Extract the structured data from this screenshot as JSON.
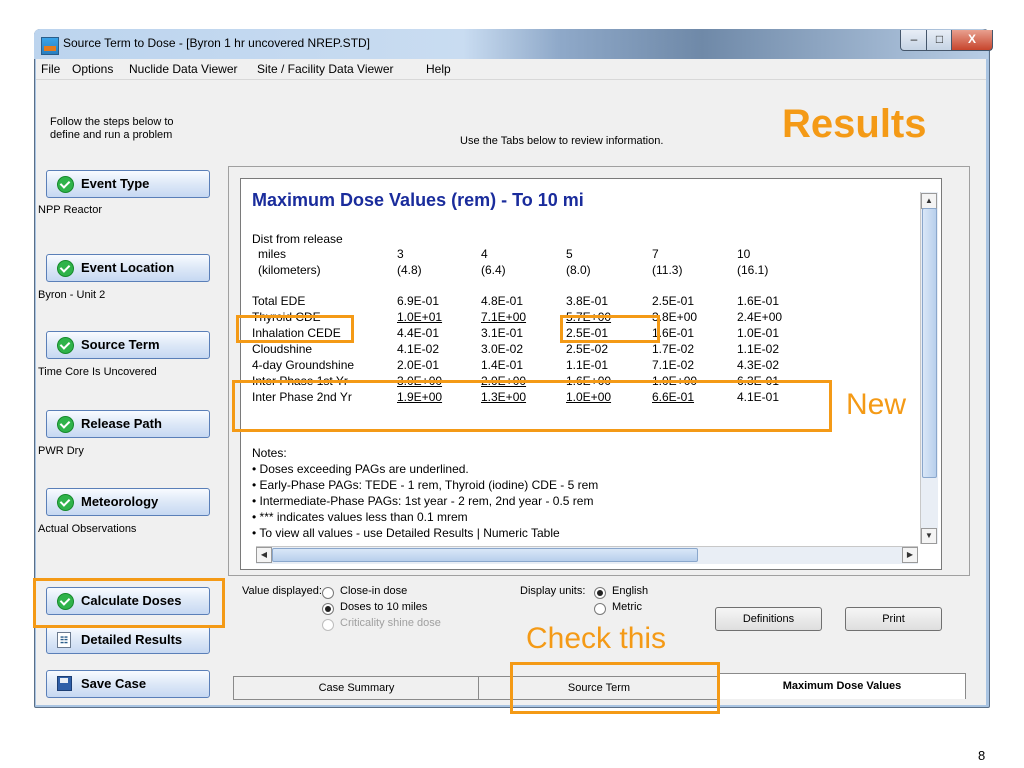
{
  "window": {
    "title": "Source Term to Dose - [Byron 1 hr uncovered NREP.STD]",
    "minimize": "–",
    "maximize": "□",
    "close": "X"
  },
  "menu": [
    "File",
    "Options",
    "Nuclide Data Viewer",
    "Site / Facility Data Viewer",
    "Help"
  ],
  "instructions": {
    "line1": "Follow the steps below to",
    "line2": "define and run a problem",
    "tabs_hint": "Use the Tabs below to review information."
  },
  "results_heading": "Results",
  "steps": [
    {
      "label": "Event Type",
      "value": "NPP Reactor",
      "icon": "check-icon"
    },
    {
      "label": "Event Location",
      "value": "Byron - Unit 2",
      "icon": "check-icon"
    },
    {
      "label": "Source Term",
      "value": "Time Core Is Uncovered",
      "icon": "check-icon"
    },
    {
      "label": "Release Path",
      "value": "PWR Dry",
      "icon": "check-icon"
    },
    {
      "label": "Meteorology",
      "value": "Actual Observations",
      "icon": "check-icon"
    }
  ],
  "actions": {
    "calculate": "Calculate Doses",
    "detailed": "Detailed Results",
    "save": "Save Case"
  },
  "report": {
    "title": "Maximum Dose Values (rem) - To 10 mi",
    "dist_header": "Dist from release",
    "miles_label": "miles",
    "km_label": "(kilometers)",
    "miles": [
      "3",
      "4",
      "5",
      "7",
      "10"
    ],
    "km": [
      "(4.8)",
      "(6.4)",
      "(8.0)",
      "(11.3)",
      "(16.1)"
    ],
    "rows": [
      {
        "label": "Total EDE",
        "values": [
          "6.9E-01",
          "4.8E-01",
          "3.8E-01",
          "2.5E-01",
          "1.6E-01"
        ]
      },
      {
        "label": "Thyroid CDE",
        "values": [
          "1.0E+01",
          "7.1E+00",
          "5.7E+00",
          "3.8E+00",
          "2.4E+00"
        ]
      },
      {
        "label": "Inhalation CEDE",
        "values": [
          "4.4E-01",
          "3.1E-01",
          "2.5E-01",
          "1.6E-01",
          "1.0E-01"
        ]
      },
      {
        "label": "Cloudshine",
        "values": [
          "4.1E-02",
          "3.0E-02",
          "2.5E-02",
          "1.7E-02",
          "1.1E-02"
        ]
      },
      {
        "label": "4-day Groundshine",
        "values": [
          "2.0E-01",
          "1.4E-01",
          "1.1E-01",
          "7.1E-02",
          "4.3E-02"
        ]
      },
      {
        "label": "Inter Phase 1st Yr",
        "values": [
          "3.0E+00",
          "2.0E+00",
          "1.6E+00",
          "1.0E+00",
          "6.3E-01"
        ]
      },
      {
        "label": "Inter Phase 2nd Yr",
        "values": [
          "1.9E+00",
          "1.3E+00",
          "1.0E+00",
          "6.6E-01",
          "4.1E-01"
        ]
      }
    ],
    "notes": [
      "Notes:",
      "• Doses exceeding PAGs are underlined.",
      "• Early-Phase PAGs: TEDE - 1 rem, Thyroid (iodine) CDE - 5 rem",
      "• Intermediate-Phase PAGs: 1st year - 2 rem, 2nd year - 0.5 rem",
      "• *** indicates values less than 0.1 mrem",
      "• To view all values - use Detailed Results | Numeric Table"
    ]
  },
  "options": {
    "value_displayed_label": "Value displayed:",
    "value_options": [
      "Close-in dose",
      "Doses to 10 miles",
      "Criticality shine dose"
    ],
    "display_units_label": "Display units:",
    "unit_options": [
      "English",
      "Metric"
    ],
    "definitions": "Definitions",
    "print": "Print"
  },
  "tabs": [
    "Case Summary",
    "Source Term",
    "Maximum Dose Values"
  ],
  "annotations": {
    "new": "New",
    "check_this": "Check this"
  },
  "page_number": "8",
  "colors": {
    "accent_orange": "#f49a16",
    "report_title_blue": "#1a2c9c",
    "check_green": "#2fb34a"
  }
}
